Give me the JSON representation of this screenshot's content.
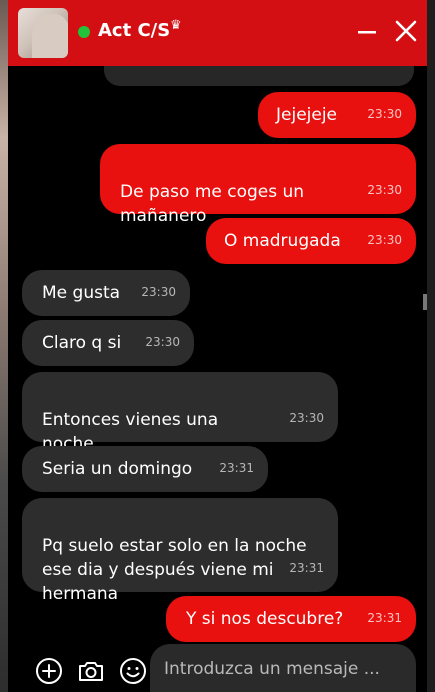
{
  "header": {
    "title": "Act C/S",
    "crown_icon": "crown-icon",
    "online_color": "#24c23a",
    "accent": "#d40f14"
  },
  "messages": [
    {
      "direction": "out",
      "text": "Jejejeje",
      "time": "23:30"
    },
    {
      "direction": "out",
      "text": "De paso me coges un\nmañanero",
      "time": "23:30"
    },
    {
      "direction": "out",
      "text": "O madrugada",
      "time": "23:30"
    },
    {
      "direction": "in",
      "text": "Me gusta",
      "time": "23:30"
    },
    {
      "direction": "in",
      "text": "Claro q si",
      "time": "23:30"
    },
    {
      "direction": "in",
      "text": "Entonces vienes una\nnoche",
      "time": "23:30"
    },
    {
      "direction": "in",
      "text": "Seria un domingo",
      "time": "23:31"
    },
    {
      "direction": "in",
      "text": "Pq suelo estar solo en la noche\nese dia y después viene mi\nhermana",
      "time": "23:31"
    },
    {
      "direction": "out",
      "text": "Y si nos descubre?",
      "time": "23:31"
    }
  ],
  "composer": {
    "placeholder": "Introduzca un mensaje ...",
    "buttons": [
      "add-icon",
      "camera-icon",
      "emoji-icon"
    ]
  }
}
